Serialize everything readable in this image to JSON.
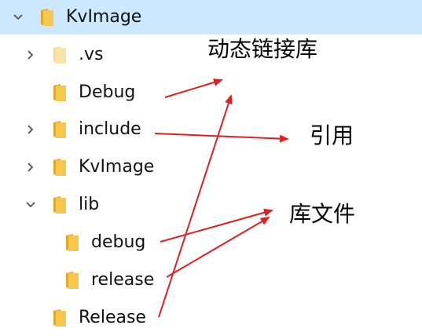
{
  "colors": {
    "selection": "#cce8ff",
    "chevron": "#606060",
    "folder_front": "#f4c84d",
    "folder_back": "#e1a82a",
    "folder_faded": "#f8e3a8",
    "arrow": "#e02020"
  },
  "icons": {
    "expand": "chevron-right-icon",
    "collapse": "chevron-down-icon",
    "folder": "folder-icon"
  },
  "tree": {
    "root": {
      "label": "KvImage",
      "expanded": true,
      "selected": true
    },
    "items": [
      {
        "label": ".vs",
        "has_children": true,
        "expanded": false,
        "hidden": true
      },
      {
        "label": "Debug",
        "has_children": false
      },
      {
        "label": "include",
        "has_children": true,
        "expanded": false
      },
      {
        "label": "KvImage",
        "has_children": true,
        "expanded": false
      },
      {
        "label": "lib",
        "has_children": true,
        "expanded": true
      },
      {
        "label": "debug",
        "has_children": false
      },
      {
        "label": "release",
        "has_children": false
      },
      {
        "label": "Release",
        "has_children": false
      }
    ]
  },
  "annotations": {
    "dynamic_lib": "动态链接库",
    "reference": "引用",
    "lib_files": "库文件"
  }
}
